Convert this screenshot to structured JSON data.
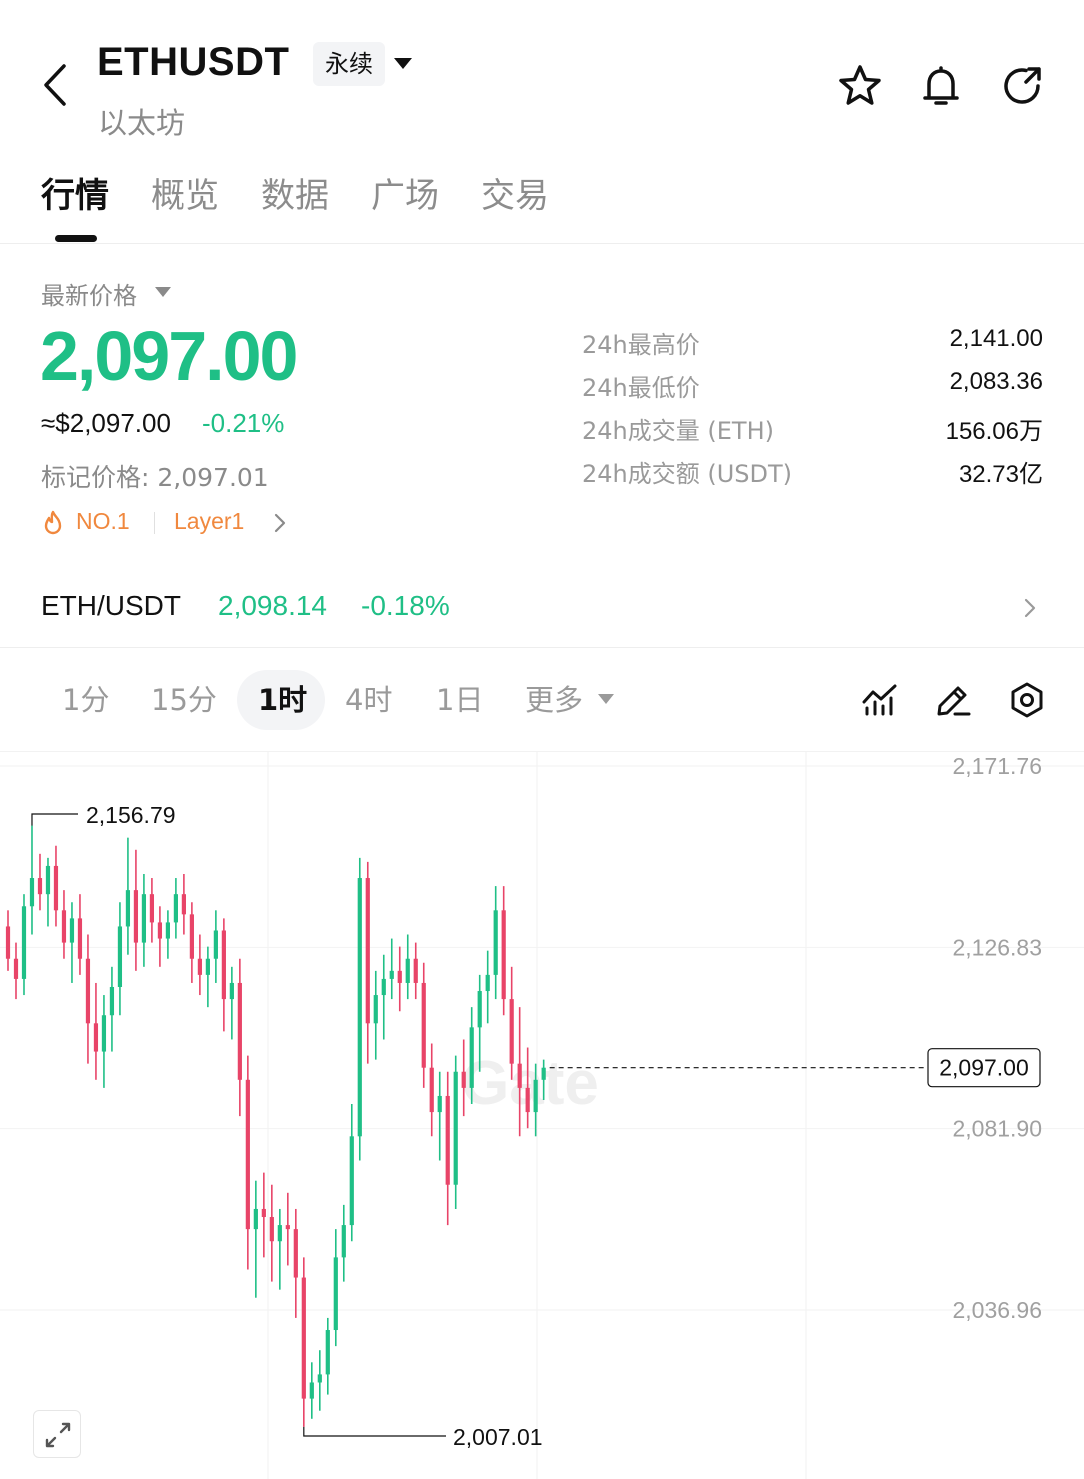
{
  "header": {
    "symbol": "ETHUSDT",
    "contract_type": "永续",
    "name": "以太坊",
    "icons": [
      "back-arrow-icon",
      "star-icon",
      "bell-icon",
      "refresh-share-icon"
    ]
  },
  "tabs": [
    {
      "label": "行情",
      "active": true
    },
    {
      "label": "概览",
      "active": false
    },
    {
      "label": "数据",
      "active": false
    },
    {
      "label": "广场",
      "active": false
    },
    {
      "label": "交易",
      "active": false
    }
  ],
  "price": {
    "label": "最新价格",
    "last": "2,097.00",
    "usd": "≈$2,097.00",
    "change_pct": "-0.21%",
    "mark": "标记价格: 2,097.01",
    "rank": "NO.1",
    "sector": "Layer1",
    "accent_color": "#1fbf86",
    "tag_color": "#f0883e"
  },
  "stats": [
    {
      "label": "24h最高价",
      "value": "2,141.00"
    },
    {
      "label": "24h最低价",
      "value": "2,083.36"
    },
    {
      "label": "24h成交量 (ETH)",
      "value": "156.06万"
    },
    {
      "label": "24h成交额 (USDT)",
      "value": "32.73亿"
    }
  ],
  "spot": {
    "pair": "ETH/USDT",
    "price": "2,098.14",
    "change_pct": "-0.18%"
  },
  "intervals": {
    "items": [
      {
        "label": "1分",
        "active": false
      },
      {
        "label": "15分",
        "active": false
      },
      {
        "label": "1时",
        "active": true
      },
      {
        "label": "4时",
        "active": false
      },
      {
        "label": "1日",
        "active": false
      },
      {
        "label": "更多",
        "active": false
      }
    ],
    "tools": [
      "indicator-icon",
      "draw-icon",
      "settings-icon"
    ]
  },
  "chart_data": {
    "type": "candlestick",
    "interval": "1时",
    "y_ticks": [
      2171.76,
      2126.83,
      2081.9,
      2036.96
    ],
    "ylim": [
      2000.0,
      2175.0
    ],
    "high_label": "2,156.79",
    "low_label": "2,007.01",
    "current_label": "2,097.00",
    "current_value": 2097.0,
    "watermark": "Gate",
    "up_color": "#1fbf86",
    "down_color": "#e84468",
    "candles_ohlc": [
      [
        2132,
        2136,
        2121,
        2124
      ],
      [
        2124,
        2128,
        2114,
        2119
      ],
      [
        2119,
        2140,
        2115,
        2137
      ],
      [
        2137,
        2157,
        2130,
        2144
      ],
      [
        2144,
        2150,
        2136,
        2140
      ],
      [
        2140,
        2149,
        2132,
        2147
      ],
      [
        2147,
        2152,
        2132,
        2136
      ],
      [
        2136,
        2141,
        2124,
        2128
      ],
      [
        2128,
        2138,
        2118,
        2134
      ],
      [
        2134,
        2140,
        2120,
        2124
      ],
      [
        2124,
        2130,
        2098,
        2108
      ],
      [
        2108,
        2118,
        2094,
        2101
      ],
      [
        2101,
        2115,
        2092,
        2110
      ],
      [
        2110,
        2122,
        2101,
        2117
      ],
      [
        2117,
        2138,
        2110,
        2132
      ],
      [
        2132,
        2154,
        2125,
        2141
      ],
      [
        2141,
        2151,
        2121,
        2128
      ],
      [
        2128,
        2145,
        2122,
        2140
      ],
      [
        2140,
        2144,
        2128,
        2133
      ],
      [
        2133,
        2137,
        2122,
        2129
      ],
      [
        2129,
        2136,
        2124,
        2133
      ],
      [
        2133,
        2144,
        2129,
        2140
      ],
      [
        2140,
        2145,
        2130,
        2135
      ],
      [
        2135,
        2138,
        2118,
        2124
      ],
      [
        2124,
        2130,
        2115,
        2120
      ],
      [
        2120,
        2127,
        2112,
        2124
      ],
      [
        2124,
        2136,
        2118,
        2131
      ],
      [
        2131,
        2134,
        2106,
        2114
      ],
      [
        2114,
        2122,
        2104,
        2118
      ],
      [
        2118,
        2124,
        2085,
        2094
      ],
      [
        2094,
        2100,
        2047,
        2057
      ],
      [
        2057,
        2069,
        2040,
        2062
      ],
      [
        2062,
        2071,
        2050,
        2060
      ],
      [
        2060,
        2068,
        2044,
        2054
      ],
      [
        2054,
        2062,
        2042,
        2058
      ],
      [
        2058,
        2066,
        2048,
        2057
      ],
      [
        2057,
        2062,
        2035,
        2045
      ],
      [
        2045,
        2050,
        2008,
        2015
      ],
      [
        2015,
        2024,
        2010,
        2019
      ],
      [
        2019,
        2027,
        2012,
        2021
      ],
      [
        2021,
        2035,
        2016,
        2032
      ],
      [
        2032,
        2057,
        2028,
        2050
      ],
      [
        2050,
        2063,
        2044,
        2058
      ],
      [
        2058,
        2088,
        2054,
        2080
      ],
      [
        2080,
        2149,
        2074,
        2144
      ],
      [
        2144,
        2148,
        2098,
        2108
      ],
      [
        2108,
        2121,
        2099,
        2115
      ],
      [
        2115,
        2125,
        2104,
        2119
      ],
      [
        2119,
        2129,
        2114,
        2121
      ],
      [
        2121,
        2127,
        2111,
        2118
      ],
      [
        2118,
        2130,
        2114,
        2124
      ],
      [
        2124,
        2128,
        2114,
        2118
      ],
      [
        2118,
        2123,
        2092,
        2097
      ],
      [
        2097,
        2103,
        2080,
        2086
      ],
      [
        2086,
        2096,
        2074,
        2090
      ],
      [
        2090,
        2096,
        2058,
        2068
      ],
      [
        2068,
        2100,
        2062,
        2096
      ],
      [
        2096,
        2104,
        2085,
        2092
      ],
      [
        2092,
        2112,
        2088,
        2107
      ],
      [
        2107,
        2120,
        2096,
        2116
      ],
      [
        2116,
        2126,
        2108,
        2120
      ],
      [
        2120,
        2142,
        2114,
        2136
      ],
      [
        2136,
        2142,
        2110,
        2114
      ],
      [
        2114,
        2122,
        2094,
        2098
      ],
      [
        2098,
        2112,
        2080,
        2092
      ],
      [
        2092,
        2102,
        2082,
        2086
      ],
      [
        2086,
        2098,
        2080,
        2094
      ],
      [
        2094,
        2099,
        2089,
        2097
      ]
    ]
  }
}
